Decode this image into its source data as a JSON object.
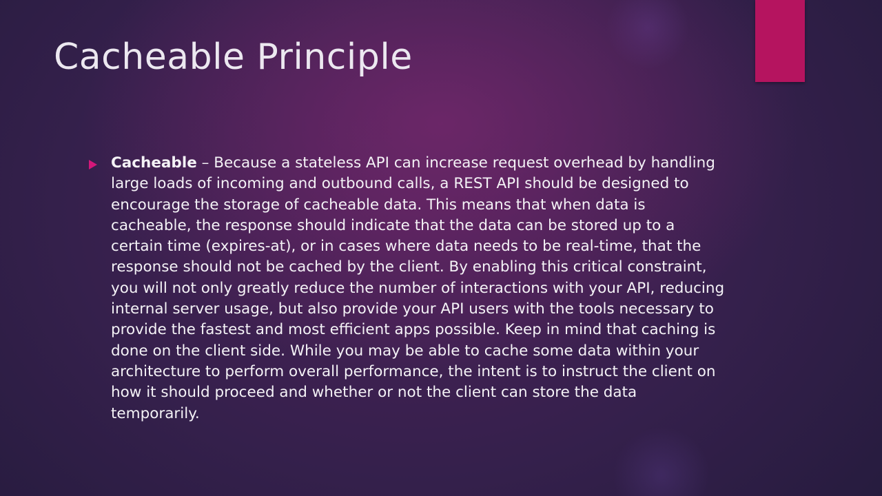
{
  "slide": {
    "title": "Cacheable Principle",
    "accent_color": "#b5145f",
    "bullet_color": "#d4177a",
    "bullet_icon": "triangle-right-icon",
    "bullets": [
      {
        "term": "Cacheable",
        "text": " – Because a stateless API can increase request overhead by handling large loads of incoming and outbound calls, a REST API should be designed to encourage the storage of cacheable data. This means that when data is cacheable, the response should indicate that the data can be stored up to a certain time (expires-at), or in cases where data needs to be real-time, that the response should not be cached by the client. By enabling this critical constraint, you will not only greatly reduce the number of interactions with your API, reducing internal server usage, but also provide your API users with the tools necessary to provide the fastest and most efficient apps possible. Keep in mind that caching is done on the client side. While you may be able to cache some data within your architecture to perform overall performance, the intent is to instruct the client on how it should proceed and whether or not the client can store the data temporarily."
      }
    ]
  }
}
